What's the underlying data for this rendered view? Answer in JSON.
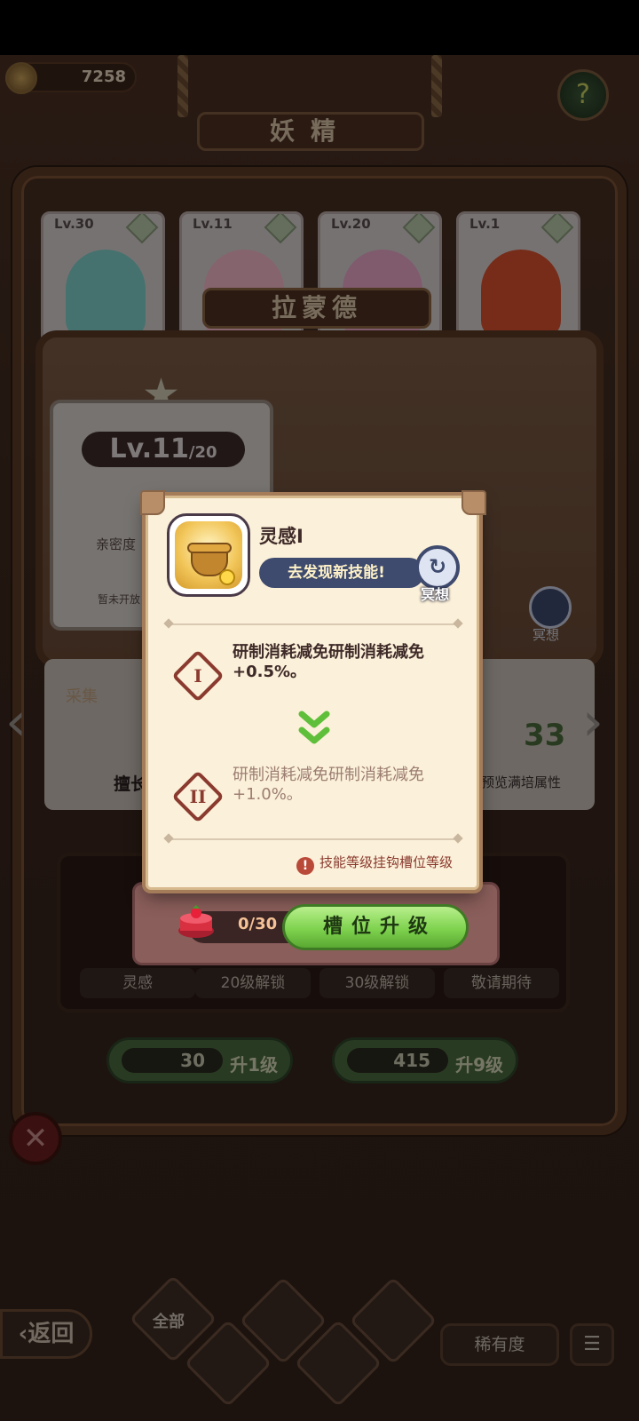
{
  "header": {
    "coins": "7258",
    "title": "妖精",
    "help_icon": "question-leaf-icon"
  },
  "fairy_cards": [
    {
      "level": "Lv.30",
      "color": "#7fcfc8"
    },
    {
      "level": "Lv.11",
      "color": "#f2b6c8"
    },
    {
      "level": "Lv.20",
      "color": "#e8a6c6"
    },
    {
      "level": "Lv.1",
      "color": "#d8502e"
    }
  ],
  "character": {
    "name": "拉蒙德",
    "level": "Lv.11",
    "level_max": "/20",
    "affinity_label": "亲密度",
    "affinity_status": "暂未开放"
  },
  "background": {
    "tab_label": "采集",
    "skill_label": "擅长",
    "preview_label": "预览满培属性",
    "stat_value": "33",
    "meditate_label": "冥想"
  },
  "slots": [
    {
      "label": "灵感"
    },
    {
      "label": "20级解锁"
    },
    {
      "label": "30级解锁"
    },
    {
      "label": "敬请期待"
    }
  ],
  "upgrade_buttons": [
    {
      "cost": "30",
      "label": "升1级"
    },
    {
      "cost": "415",
      "label": "升9级"
    }
  ],
  "bottom_nav": {
    "back": "返回",
    "all": "全部",
    "rarity": "稀有度"
  },
  "modal": {
    "skill_name": "灵感Ⅰ",
    "discover_label": "去发现新技能!",
    "meditate_label": "冥想",
    "tier1_numeral": "I",
    "tier1_text": "研制消耗减免研制消耗减免+0.5%。",
    "tier2_numeral": "II",
    "tier2_text": "研制消耗减免研制消耗减免+1.0%。",
    "warning": "技能等级挂钩槽位等级",
    "cost": "0/30",
    "upgrade_button": "槽位升级"
  },
  "colors": {
    "upgrade_green": "#7ed24e",
    "modal_bg": "#fbf0d9",
    "discover_bg": "#3e4a6e",
    "tier_red": "#8a3a2e"
  }
}
